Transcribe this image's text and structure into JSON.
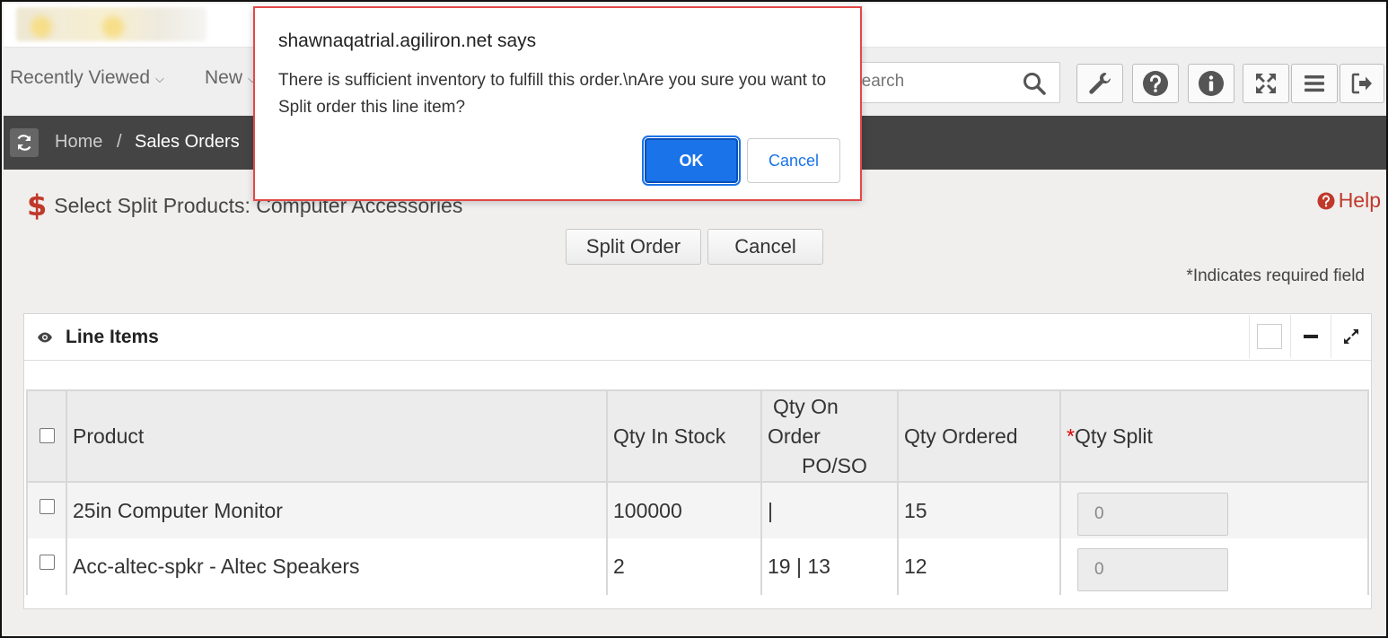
{
  "nav": {
    "recently_viewed": "Recently Viewed",
    "new": "New",
    "search_placeholder": "Search"
  },
  "breadcrumb": {
    "home": "Home",
    "separator": "/",
    "current": "Sales Orders"
  },
  "page": {
    "title": "Select Split Products:  Computer Accessories",
    "help": "Help",
    "split_order_button": "Split Order",
    "cancel_button": "Cancel",
    "required_note": "*Indicates required field"
  },
  "panel": {
    "title": "Line Items",
    "columns": {
      "product": "Product",
      "qty_in_stock": "Qty In Stock",
      "qty_on_order_line1": "Qty On",
      "qty_on_order_line2": "Order",
      "qty_on_order_line3": "PO/SO",
      "qty_ordered": "Qty Ordered",
      "qty_split_star": "*",
      "qty_split": "Qty Split"
    },
    "rows": [
      {
        "product": "25in Computer Monitor",
        "qty_in_stock": "100000",
        "qty_on_order": "|",
        "qty_ordered": "15",
        "qty_split": "0"
      },
      {
        "product": "Acc-altec-spkr - Altec Speakers",
        "qty_in_stock": "2",
        "qty_on_order": "19 | 13",
        "qty_ordered": "12",
        "qty_split": "0"
      }
    ]
  },
  "dialog": {
    "title": "shawnaqatrial.agiliron.net says",
    "message": "There is sufficient inventory to fulfill this order.\\nAre you sure you want to  Split order this line item?",
    "ok": "OK",
    "cancel": "Cancel"
  },
  "colors": {
    "accent_red": "#c0392b",
    "dialog_button_blue": "#1a73e8",
    "breadcrumb_bar": "#444444"
  }
}
